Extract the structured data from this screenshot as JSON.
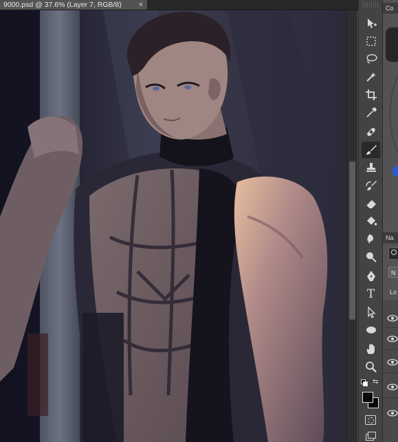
{
  "document": {
    "tab_title": "9000.psd @ 37.6% (Layer 7, RGB/8)",
    "close_glyph": "×"
  },
  "toolbar": {
    "tools": [
      {
        "name": "move-tool",
        "icon": "move-icon",
        "active": false
      },
      {
        "name": "marquee-tool",
        "icon": "marquee-icon",
        "active": false
      },
      {
        "name": "lasso-tool",
        "icon": "lasso-icon",
        "active": false
      },
      {
        "name": "magic-wand-tool",
        "icon": "magic-wand-icon",
        "active": false
      },
      {
        "name": "crop-tool",
        "icon": "crop-icon",
        "active": false
      },
      {
        "name": "eyedropper-tool",
        "icon": "eyedropper-icon",
        "active": false
      },
      {
        "name": "healing-brush-tool",
        "icon": "bandage-icon",
        "active": false
      },
      {
        "name": "brush-tool",
        "icon": "brush-icon",
        "active": true
      },
      {
        "name": "clone-stamp-tool",
        "icon": "stamp-icon",
        "active": false
      },
      {
        "name": "history-brush-tool",
        "icon": "history-brush-icon",
        "active": false
      },
      {
        "name": "eraser-tool",
        "icon": "eraser-icon",
        "active": false
      },
      {
        "name": "paint-bucket-tool",
        "icon": "paint-bucket-icon",
        "active": false
      },
      {
        "name": "smudge-tool",
        "icon": "smudge-icon",
        "active": false
      },
      {
        "name": "dodge-tool",
        "icon": "dodge-icon",
        "active": false
      },
      {
        "name": "pen-tool",
        "icon": "pen-icon",
        "active": false
      },
      {
        "name": "type-tool",
        "icon": "type-icon",
        "active": false
      },
      {
        "name": "path-selection-tool",
        "icon": "arrow-icon",
        "active": false
      },
      {
        "name": "ellipse-tool",
        "icon": "ellipse-icon",
        "active": false
      },
      {
        "name": "hand-tool",
        "icon": "hand-icon",
        "active": false
      },
      {
        "name": "zoom-tool",
        "icon": "zoom-icon",
        "active": false
      }
    ],
    "type_glyph": "T",
    "foreground_color": "#0a0a0a",
    "background_color": "#0a0a0a"
  },
  "panels": {
    "color_header": "Co",
    "navigator_header": "Na",
    "layers_filter": "N",
    "lock_label": "Lo"
  }
}
